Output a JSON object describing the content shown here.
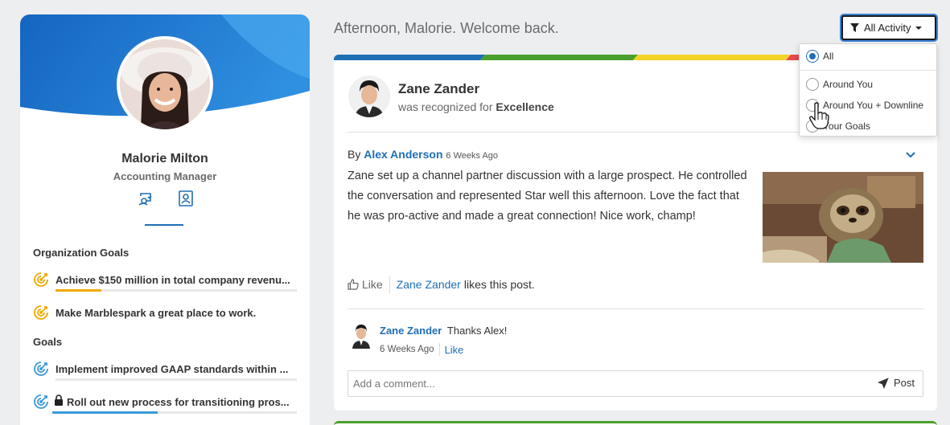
{
  "profile": {
    "name": "Malorie Milton",
    "title": "Accounting Manager",
    "org_goals_heading": "Organization Goals",
    "goals_heading": "Goals",
    "org_goals": [
      {
        "label": "Achieve $150 million in total company revenu...",
        "progress": 0.19,
        "color": "#f0a800"
      },
      {
        "label": "Make Marblespark a great place to work.",
        "progress": 0,
        "color": "#f0a800"
      }
    ],
    "goals": [
      {
        "label": "Implement improved GAAP standards within ...",
        "progress": 0,
        "color": "#3a9ad9"
      },
      {
        "label": "Roll out new process for transitioning pros...",
        "progress": 0.43,
        "color": "#3a9ad9",
        "locked": true
      }
    ]
  },
  "header": {
    "welcome": "Afternoon, Malorie. Welcome back.",
    "filter_label": "All Activity"
  },
  "filter_menu": {
    "options": [
      {
        "label": "All",
        "selected": true
      },
      {
        "label": "Around You",
        "selected": false
      },
      {
        "label": "Around You + Downline",
        "selected": false
      },
      {
        "label": "Your Goals",
        "selected": false
      }
    ]
  },
  "post": {
    "recipient": "Zane Zander",
    "recognized_prefix": "was recognized for",
    "value": "Excellence",
    "by_prefix": "By",
    "author": "Alex Anderson",
    "ago": "6 Weeks Ago",
    "body": "Zane set up a channel partner discussion with a large prospect. He controlled the conversation and represented Star well this afternoon. Love the fact that he was pro-active and made a great connection! Nice work, champ!",
    "like_label": "Like",
    "liker": "Zane Zander",
    "likes_suffix": "likes this post.",
    "comment": {
      "name": "Zane Zander",
      "text": "Thanks Alex!",
      "ago": "6 Weeks Ago",
      "like_label": "Like"
    },
    "comment_placeholder": "Add a comment...",
    "post_label": "Post"
  },
  "colors": {
    "accent": "#1f6fb5",
    "rainbow": [
      "#1f6fb5",
      "#4aa02c",
      "#f5d22a",
      "#e8484c"
    ]
  }
}
